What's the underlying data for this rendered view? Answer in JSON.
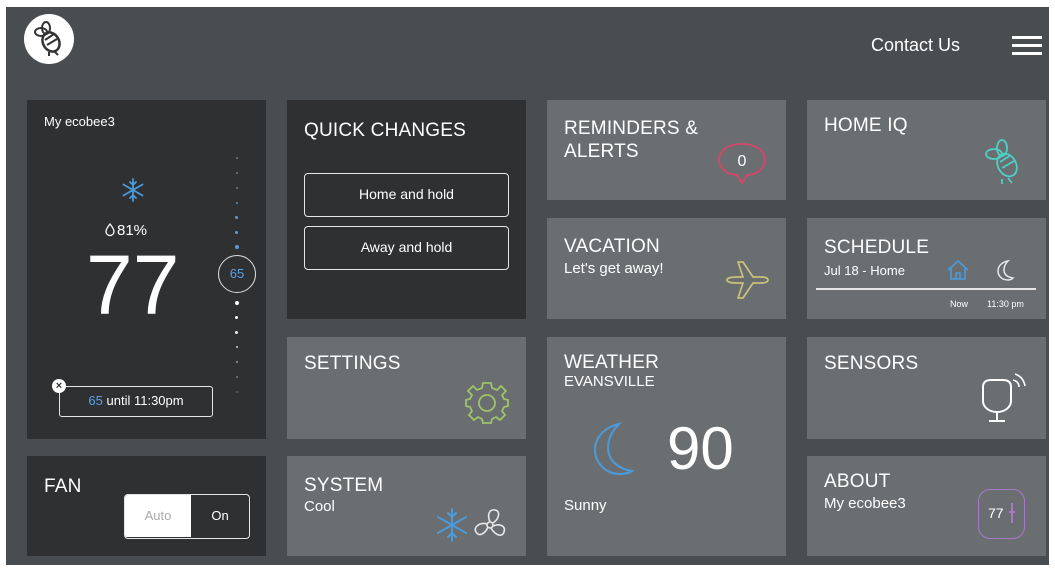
{
  "header": {
    "contact_label": "Contact Us",
    "logo_icon": "bee-logo-icon",
    "menu_icon": "hamburger-menu-icon"
  },
  "thermostat": {
    "name": "My ecobee3",
    "mode_icon": "snowflake-icon",
    "humidity": "81%",
    "temperature": "77",
    "setpoint": "65",
    "hold_setpoint": "65",
    "hold_text": "until 11:30pm"
  },
  "fan": {
    "title": "FAN",
    "options": [
      "Auto",
      "On"
    ],
    "selected": "On"
  },
  "quick_changes": {
    "title": "QUICK CHANGES",
    "buttons": [
      "Home and hold",
      "Away and hold"
    ]
  },
  "settings": {
    "title": "SETTINGS",
    "icon": "gear-icon"
  },
  "system": {
    "title": "SYSTEM",
    "mode": "Cool",
    "icons": [
      "snowflake-icon",
      "fan-icon"
    ]
  },
  "reminders": {
    "title_line1": "REMINDERS &",
    "title_line2": "ALERTS",
    "count": "0"
  },
  "vacation": {
    "title": "VACATION",
    "subtitle": "Let's get away!",
    "icon": "airplane-icon"
  },
  "weather": {
    "title": "WEATHER",
    "location": "EVANSVILLE",
    "temperature": "90",
    "condition": "Sunny",
    "icon": "moon-icon"
  },
  "home_iq": {
    "title": "HOME IQ",
    "icon": "bee-icon"
  },
  "schedule": {
    "title": "SCHEDULE",
    "subtitle": "Jul 18 - Home",
    "now_label": "Now",
    "time_label": "11:30 pm",
    "icons": [
      "home-icon",
      "moon-icon"
    ]
  },
  "sensors": {
    "title": "SENSORS",
    "icon": "sensor-icon"
  },
  "about": {
    "title": "ABOUT",
    "subtitle": "My ecobee3",
    "badge_value": "77"
  },
  "colors": {
    "background": "#4a4d50",
    "tile": "#6b6e71",
    "tile_dark": "#2f3032",
    "accent_blue": "#3d8fd4",
    "alert_pink": "#d6456a",
    "airplane_yellow": "#c9c37a",
    "gear_green": "#9fc26a",
    "bee_teal": "#4fcfc4",
    "about_purple": "#a879c9"
  }
}
